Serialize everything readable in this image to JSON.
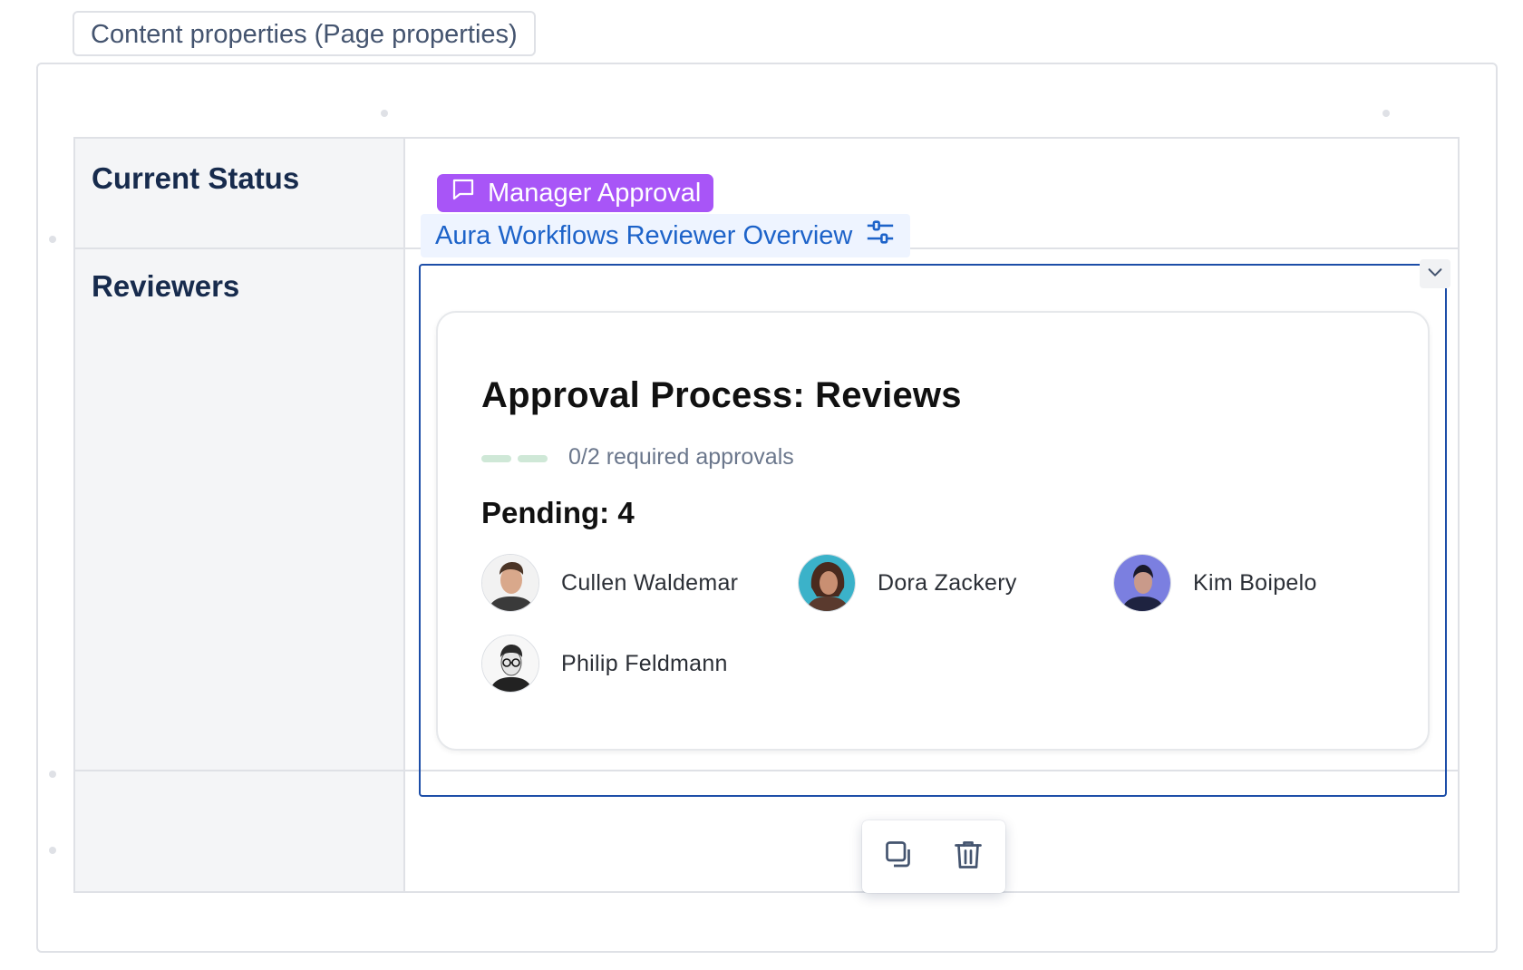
{
  "macro": {
    "label": "Content properties (Page properties)"
  },
  "table": {
    "rows": [
      {
        "header": "Current Status"
      },
      {
        "header": "Reviewers"
      },
      {
        "header": ""
      }
    ]
  },
  "status": {
    "label": "Manager Approval",
    "icon": "comment-icon",
    "color": "#a855f7"
  },
  "workflow_link": {
    "label": "Aura Workflows Reviewer Overview",
    "icon": "settings-sliders-icon"
  },
  "review_card": {
    "title": "Approval Process: Reviews",
    "progress": {
      "approved": 0,
      "required": 2,
      "text": "0/2 required approvals"
    },
    "pending_title": "Pending: 4",
    "reviewers": [
      {
        "name": "Cullen Waldemar",
        "avatar": "avatar-cullen"
      },
      {
        "name": "Dora Zackery",
        "avatar": "avatar-dora"
      },
      {
        "name": "Kim Boipelo",
        "avatar": "avatar-kim"
      },
      {
        "name": "Philip Feldmann",
        "avatar": "avatar-philip"
      }
    ]
  },
  "toolbar": {
    "copy_icon": "copy-icon",
    "delete_icon": "trash-icon"
  },
  "colors": {
    "accent": "#1d63c9",
    "frame": "#1d4ea8",
    "progress": "#cfe8d7"
  }
}
